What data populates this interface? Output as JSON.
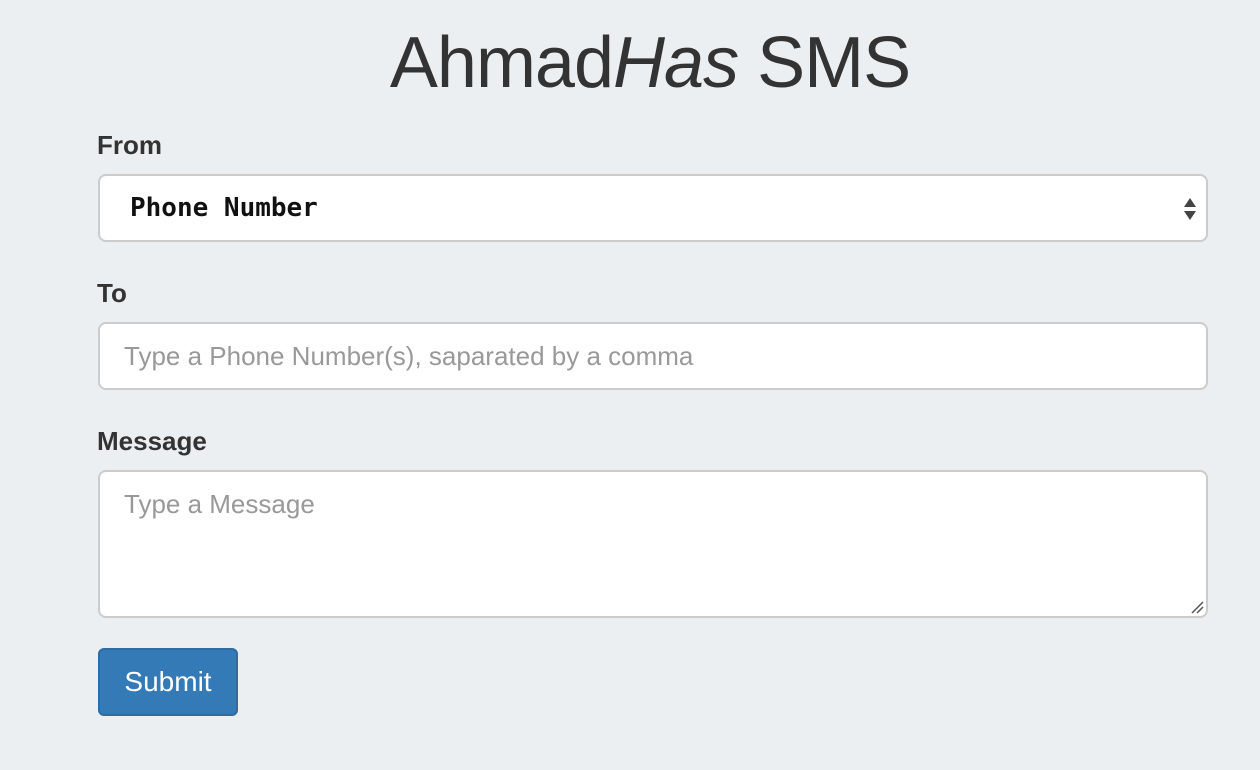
{
  "header": {
    "title_part1": "Ahmad",
    "title_part2": "Has",
    "title_part3": " SMS"
  },
  "form": {
    "from": {
      "label": "From",
      "selected_value": "Phone Number"
    },
    "to": {
      "label": "To",
      "placeholder": "Type a Phone Number(s), saparated by a comma",
      "value": ""
    },
    "message": {
      "label": "Message",
      "placeholder": "Type a Message",
      "value": ""
    },
    "submit_label": "Submit"
  },
  "colors": {
    "background": "#ebeff1",
    "primary_button": "#337ab7",
    "text": "#333333",
    "placeholder": "#999999"
  },
  "icons": {
    "select_arrows": "up-down-caret-icon",
    "resize": "resize-grip-icon"
  }
}
